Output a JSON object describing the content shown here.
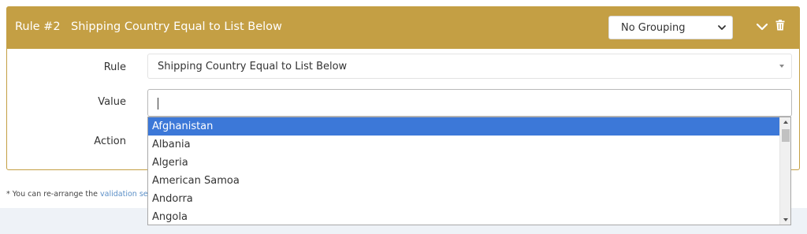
{
  "rule": {
    "number_label": "Rule #2",
    "title": "Shipping Country Equal to List Below",
    "grouping_value": "No Grouping",
    "header_color": "#c49f44"
  },
  "form": {
    "rule_label": "Rule",
    "rule_value": "Shipping Country Equal to List Below",
    "value_label": "Value",
    "value_text": "",
    "action_label": "Action"
  },
  "dropdown": {
    "options": [
      "Afghanistan",
      "Albania",
      "Algeria",
      "American Samoa",
      "Andorra",
      "Angola"
    ],
    "selected_index": 0,
    "highlight_color": "#3c78d8"
  },
  "footer": {
    "help_prefix": "* You can re-arrange the ",
    "help_link": "validation sequ"
  },
  "icons": {
    "collapse": "chevron-down-icon",
    "delete": "trash-icon",
    "select": "chevron-down-icon"
  }
}
